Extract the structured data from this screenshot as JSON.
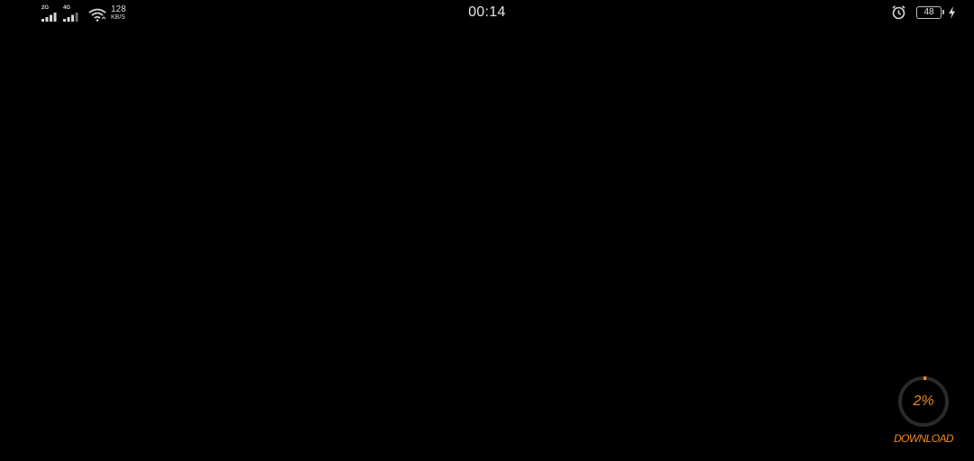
{
  "status_bar": {
    "signal_1_label": "2G",
    "signal_2_label": "4G",
    "net_speed_value": "128",
    "net_speed_unit": "KB/S",
    "time": "00:14",
    "battery_level": "48",
    "icons": [
      "signal-icon",
      "signal-icon",
      "wifi-icon",
      "alarm-icon",
      "battery-icon",
      "charging-icon"
    ]
  },
  "download": {
    "progress_percent": 2,
    "progress_label": "2%",
    "label": "DOWNLOAD",
    "accent_color": "#f0891e",
    "track_color": "#2a2a2a"
  }
}
